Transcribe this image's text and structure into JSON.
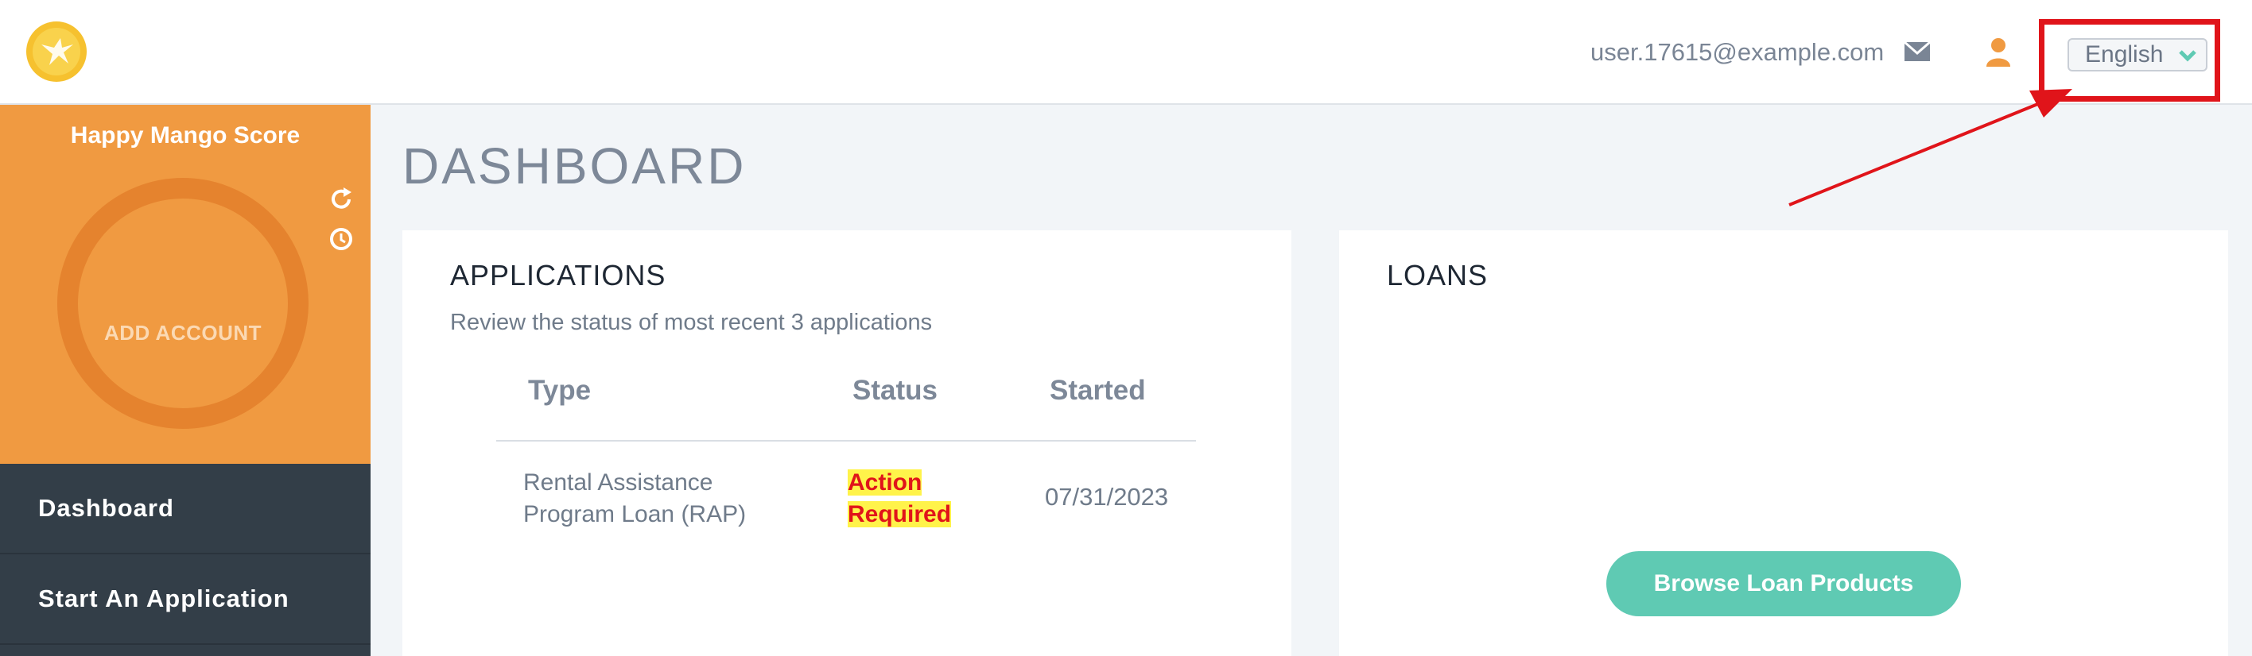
{
  "header": {
    "user_email": "user.17615@example.com",
    "language": "English"
  },
  "sidebar": {
    "score_title": "Happy Mango Score",
    "add_account": "ADD ACCOUNT",
    "nav_items": [
      {
        "label": "Dashboard"
      },
      {
        "label": "Start An Application"
      }
    ]
  },
  "main": {
    "page_title": "DASHBOARD",
    "applications": {
      "title": "APPLICATIONS",
      "subtitle": "Review the status of most recent 3 applications",
      "columns": [
        "Type",
        "Status",
        "Started"
      ],
      "rows": [
        {
          "type_line1": "Rental Assistance",
          "type_line2": "Program Loan (RAP)",
          "status_line1": "Action",
          "status_line2": "Required",
          "started": "07/31/2023"
        }
      ]
    },
    "loans": {
      "title": "LOANS",
      "browse_button": "Browse Loan Products"
    }
  },
  "colors": {
    "brand_orange": "#f09a41",
    "sidebar_dark": "#333e48",
    "accent_teal": "#5fcab3",
    "alert_red": "#e0141a",
    "highlight_yellow": "#fff34a",
    "annotation_red": "#e0141a"
  },
  "icons": [
    "logo-icon",
    "mail-icon",
    "person-icon",
    "chevron-down-icon",
    "refresh-icon",
    "history-icon"
  ]
}
